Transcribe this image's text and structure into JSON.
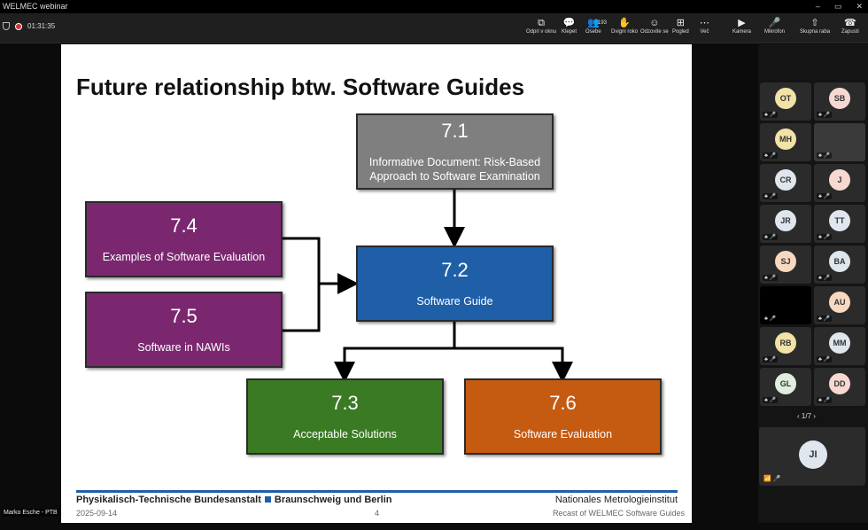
{
  "window": {
    "title": "WELMEC webinar",
    "controls": [
      "–",
      "▭",
      "✕"
    ]
  },
  "toolbar": {
    "timer": "01:31:35",
    "buttons": [
      {
        "icon": "popout-icon",
        "glyph": "⧉",
        "label": "Odpri v oknu"
      },
      {
        "icon": "chat-icon",
        "glyph": "💬",
        "label": "Klepet"
      },
      {
        "icon": "people-icon",
        "glyph": "👥",
        "label": "Osebe",
        "count": "193"
      },
      {
        "icon": "raise-hand-icon",
        "glyph": "✋",
        "label": "Dvigni roko"
      },
      {
        "icon": "react-icon",
        "glyph": "☺",
        "label": "Odzovite se"
      },
      {
        "icon": "view-icon",
        "glyph": "⊞",
        "label": "Pogled"
      },
      {
        "icon": "more-icon",
        "glyph": "⋯",
        "label": "Več"
      },
      {
        "icon": "camera-icon",
        "glyph": "▶",
        "label": "Kamera"
      },
      {
        "icon": "mic-off-icon",
        "glyph": "🎤",
        "label": "Mikrofon"
      },
      {
        "icon": "share-icon",
        "glyph": "⇧",
        "label": "Skupna raba"
      },
      {
        "icon": "leave-icon",
        "glyph": "☎",
        "label": "Zapusti"
      }
    ]
  },
  "slide": {
    "title": "Future relationship btw. Software Guides",
    "boxes": [
      {
        "id": "7.1",
        "label": "Informative Document: Risk-Based Approach to Software Examination",
        "color": "#7f7f7f"
      },
      {
        "id": "7.2",
        "label": "Software Guide",
        "color": "#1f5fa8"
      },
      {
        "id": "7.3",
        "label": "Acceptable Solutions",
        "color": "#3a7a23"
      },
      {
        "id": "7.4",
        "label": "Examples of Software Evaluation",
        "color": "#7b2770"
      },
      {
        "id": "7.5",
        "label": "Software in NAWIs",
        "color": "#7b2770"
      },
      {
        "id": "7.6",
        "label": "Software Evaluation",
        "color": "#c55a11"
      }
    ],
    "footer": {
      "org": "Physikalisch-Technische Bundesanstalt",
      "location": "Braunschweig und Berlin",
      "institute": "Nationales Metrologieinstitut",
      "date": "2025-09-14",
      "page": "4",
      "subtitle": "Recast of WELMEC Software Guides"
    }
  },
  "presenter": {
    "name": "Marko Esche - PTB"
  },
  "participants": [
    {
      "initials": "OT",
      "color": "#f2e2a6"
    },
    {
      "initials": "SB",
      "color": "#f7d9d2"
    },
    {
      "initials": "MH",
      "color": "#f2e2a6"
    },
    {
      "initials": "",
      "color": "#3a3a3a",
      "video": true
    },
    {
      "initials": "CR",
      "color": "#dfe6ee"
    },
    {
      "initials": "J",
      "color": "#f7d9d2"
    },
    {
      "initials": "JR",
      "color": "#dfe6ee"
    },
    {
      "initials": "TT",
      "color": "#dfe6ee"
    },
    {
      "initials": "SJ",
      "color": "#f7d9c2"
    },
    {
      "initials": "BA",
      "color": "#dfe6ee"
    },
    {
      "initials": "",
      "color": "#000",
      "video": true
    },
    {
      "initials": "AU",
      "color": "#f7d9c2"
    },
    {
      "initials": "RB",
      "color": "#f2e2a6"
    },
    {
      "initials": "MM",
      "color": "#dfe6ee"
    },
    {
      "initials": "GL",
      "color": "#dfeedf"
    },
    {
      "initials": "DD",
      "color": "#f7d9d2"
    }
  ],
  "pager": "1/7",
  "self": {
    "initials": "JI"
  }
}
